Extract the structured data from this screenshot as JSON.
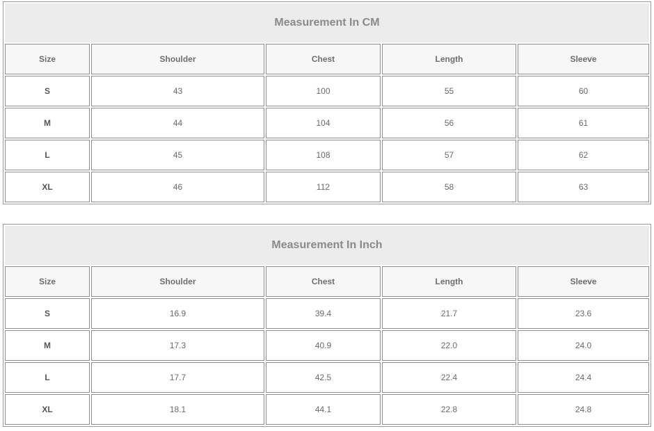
{
  "tables": [
    {
      "id": "cm",
      "title": "Measurement In CM",
      "headers": [
        "Size",
        "Shoulder",
        "Chest",
        "Length",
        "Sleeve"
      ],
      "rows": [
        [
          "S",
          "43",
          "100",
          "55",
          "60"
        ],
        [
          "M",
          "44",
          "104",
          "56",
          "61"
        ],
        [
          "L",
          "45",
          "108",
          "57",
          "62"
        ],
        [
          "XL",
          "46",
          "112",
          "58",
          "63"
        ]
      ]
    },
    {
      "id": "inch",
      "title": "Measurement In Inch",
      "headers": [
        "Size",
        "Shoulder",
        "Chest",
        "Length",
        "Sleeve"
      ],
      "rows": [
        [
          "S",
          "16.9",
          "39.4",
          "21.7",
          "23.6"
        ],
        [
          "M",
          "17.3",
          "40.9",
          "22.0",
          "24.0"
        ],
        [
          "L",
          "17.7",
          "42.5",
          "22.4",
          "24.4"
        ],
        [
          "XL",
          "18.1",
          "44.1",
          "22.8",
          "24.8"
        ]
      ]
    }
  ]
}
